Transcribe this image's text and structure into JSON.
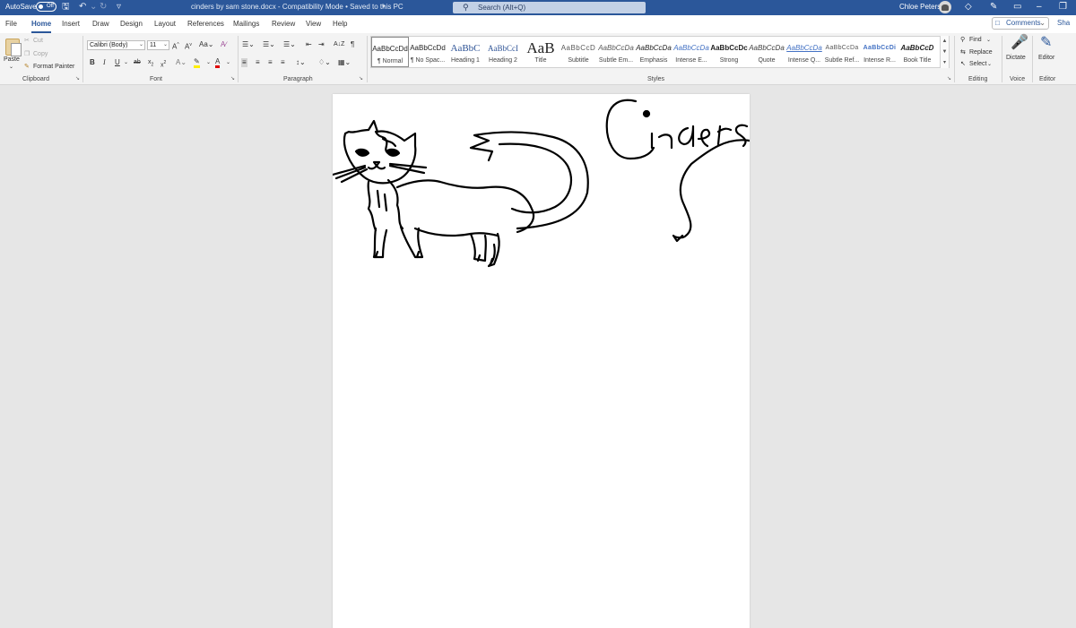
{
  "titlebar": {
    "autosave_label": "AutoSave",
    "autosave_state": "Off",
    "document_title": "cinders by sam stone.docx  -  Compatibility Mode • Saved to this PC",
    "search_placeholder": "Search (Alt+Q)",
    "user_name": "Chloe Peters",
    "color": "#2b579a"
  },
  "tabs": [
    {
      "label": "File"
    },
    {
      "label": "Home"
    },
    {
      "label": "Insert"
    },
    {
      "label": "Draw"
    },
    {
      "label": "Design"
    },
    {
      "label": "Layout"
    },
    {
      "label": "References"
    },
    {
      "label": "Mailings"
    },
    {
      "label": "Review"
    },
    {
      "label": "View"
    },
    {
      "label": "Help"
    }
  ],
  "active_tab": "Home",
  "comments_label": "Comments",
  "share_label": "Sha",
  "clipboard": {
    "group": "Clipboard",
    "paste": "Paste",
    "cut": "Cut",
    "copy": "Copy",
    "format_painter": "Format Painter"
  },
  "font": {
    "group": "Font",
    "family": "Calibri (Body)",
    "size": "11"
  },
  "paragraph": {
    "group": "Paragraph"
  },
  "styles": {
    "group": "Styles",
    "items": [
      {
        "preview": "AaBbCcDd",
        "name": "¶ Normal"
      },
      {
        "preview": "AaBbCcDd",
        "name": "¶ No Spac..."
      },
      {
        "preview": "AaBbC",
        "name": "Heading 1"
      },
      {
        "preview": "AaBbCcI",
        "name": "Heading 2"
      },
      {
        "preview": "AaB",
        "name": "Title"
      },
      {
        "preview": "AaBbCcD",
        "name": "Subtitle"
      },
      {
        "preview": "AaBbCcDa",
        "name": "Subtle Em..."
      },
      {
        "preview": "AaBbCcDa",
        "name": "Emphasis"
      },
      {
        "preview": "AaBbCcDa",
        "name": "Intense E..."
      },
      {
        "preview": "AaBbCcDc",
        "name": "Strong"
      },
      {
        "preview": "AaBbCcDa",
        "name": "Quote"
      },
      {
        "preview": "AaBbCcDa",
        "name": "Intense Q..."
      },
      {
        "preview": "AaBbCcDa",
        "name": "Subtle Ref..."
      },
      {
        "preview": "AaBbCcDi",
        "name": "Intense R..."
      },
      {
        "preview": "AaBbCcD",
        "name": "Book Title"
      }
    ]
  },
  "editing": {
    "group": "Editing",
    "find": "Find",
    "replace": "Replace",
    "select": "Select"
  },
  "voice": {
    "group": "Voice",
    "dictate": "Dictate"
  },
  "editor": {
    "group": "Editor",
    "label": "Editor"
  },
  "document": {
    "drawing_text": "Cinders"
  }
}
